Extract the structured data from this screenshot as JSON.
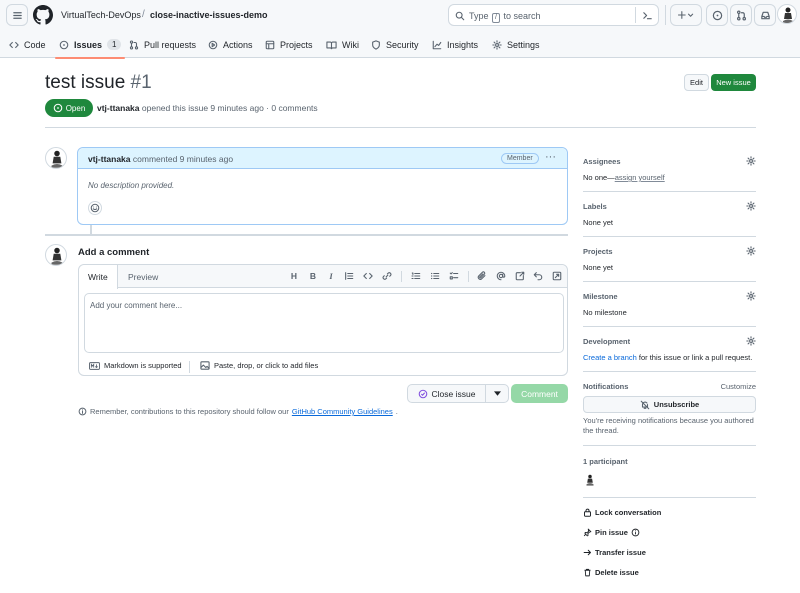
{
  "header": {
    "owner": "VirtualTech-DevOps",
    "separator": "/",
    "repo": "close-inactive-issues-demo",
    "search": {
      "before": "Type",
      "key": "/",
      "after": "to search"
    }
  },
  "tabs": [
    {
      "label": "Code"
    },
    {
      "label": "Issues",
      "count": "1"
    },
    {
      "label": "Pull requests"
    },
    {
      "label": "Actions"
    },
    {
      "label": "Projects"
    },
    {
      "label": "Wiki"
    },
    {
      "label": "Security"
    },
    {
      "label": "Insights"
    },
    {
      "label": "Settings"
    }
  ],
  "issue": {
    "title": "test issue",
    "number": "#1",
    "edit_label": "Edit",
    "new_issue_label": "New issue",
    "state": "Open",
    "author": "vtj-ttanaka",
    "meta_rest": "opened this issue 9 minutes ago · 0 comments"
  },
  "comment": {
    "author": "vtj-ttanaka",
    "time": "commented 9 minutes ago",
    "role": "Member",
    "more": "···",
    "body": "No description provided."
  },
  "composer": {
    "title": "Add a comment",
    "tab_write": "Write",
    "tab_preview": "Preview",
    "placeholder": "Add your comment here...",
    "markdown": "Markdown is supported",
    "attach": "Paste, drop, or click to add files",
    "close_label": "Close issue",
    "comment_label": "Comment",
    "guidelines_prefix": "Remember, contributions to this repository should follow our",
    "guidelines_link": "GitHub Community Guidelines",
    "guidelines_suffix": "."
  },
  "sidebar": {
    "assignees": {
      "title": "Assignees",
      "none": "No one—",
      "assign": "assign yourself"
    },
    "labels": {
      "title": "Labels",
      "value": "None yet"
    },
    "projects": {
      "title": "Projects",
      "value": "None yet"
    },
    "milestone": {
      "title": "Milestone",
      "value": "No milestone"
    },
    "development": {
      "title": "Development",
      "link": "Create a branch",
      "rest": "for this issue or link a pull request."
    },
    "notifications": {
      "title": "Notifications",
      "customize": "Customize",
      "unsubscribe": "Unsubscribe",
      "note": "You're receiving notifications because you authored the thread."
    },
    "participants": {
      "title": "1 participant"
    },
    "actions": {
      "lock": "Lock conversation",
      "pin": "Pin issue",
      "transfer": "Transfer issue",
      "delete": "Delete issue"
    }
  },
  "colors": {
    "accent_green": "#1f883d",
    "link_blue": "#0969da",
    "tab_underline": "#fd8c73"
  }
}
